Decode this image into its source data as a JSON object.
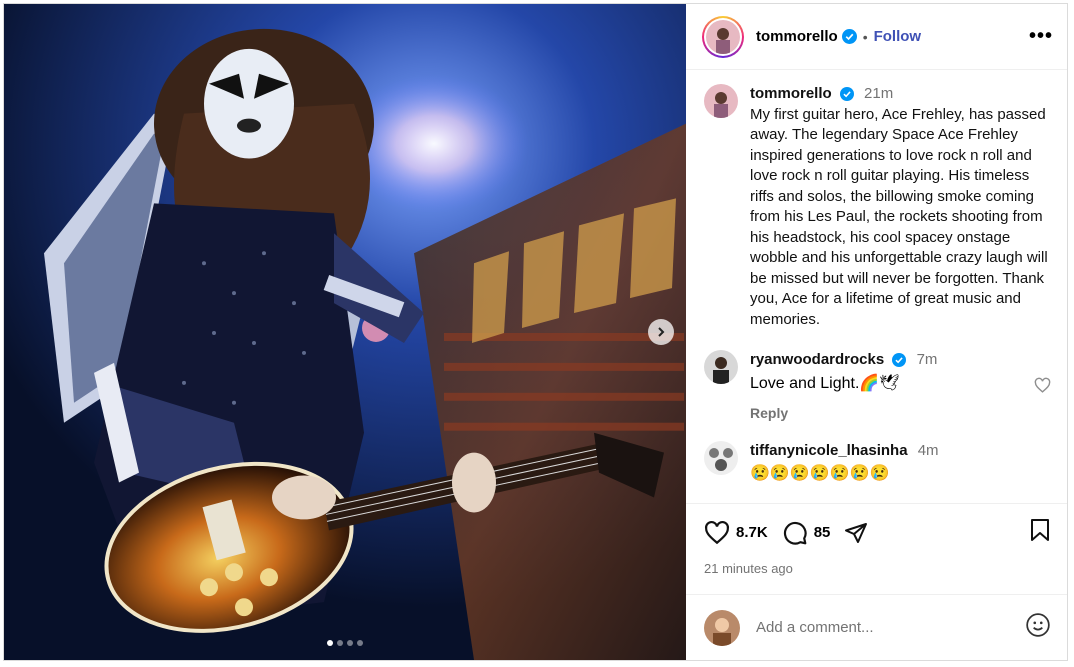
{
  "post": {
    "author": "tommorello",
    "follow_label": "Follow",
    "separator": "•",
    "more_label": "•••"
  },
  "caption": {
    "username": "tommorello",
    "time": "21m",
    "text": "My first guitar hero, Ace Frehley, has passed away. The legendary Space Ace Frehley inspired generations to love rock n roll and love rock n roll guitar playing. His timeless riffs and solos, the billowing smoke coming from his Les Paul, the rockets shooting from his headstock, his cool spacey onstage wobble and his unforgettable crazy laugh will be missed but will never be forgotten. Thank you, Ace for a lifetime of great music and memories."
  },
  "comments": [
    {
      "username": "ryanwoodardrocks",
      "time": "7m",
      "text": "Love and Light.🌈🕊",
      "reply_label": "Reply"
    },
    {
      "username": "tiffanynicole_lhasinha",
      "time": "4m",
      "text": "😢😢😢😢😢😢😢"
    }
  ],
  "actions": {
    "likes": "8.7K",
    "comments_count": "85",
    "timestamp": "21 minutes ago"
  },
  "add_comment": {
    "placeholder": "Add a comment..."
  },
  "media": {
    "slides": 4,
    "active_slide": 0
  },
  "colors": {
    "follow": "#3f51b5",
    "verified": "#0095f6",
    "muted": "#737373"
  },
  "icons": [
    "verified-badge-icon",
    "heart-icon",
    "comment-icon",
    "share-icon",
    "bookmark-icon",
    "emoji-icon",
    "chevron-right-icon",
    "more-icon"
  ]
}
